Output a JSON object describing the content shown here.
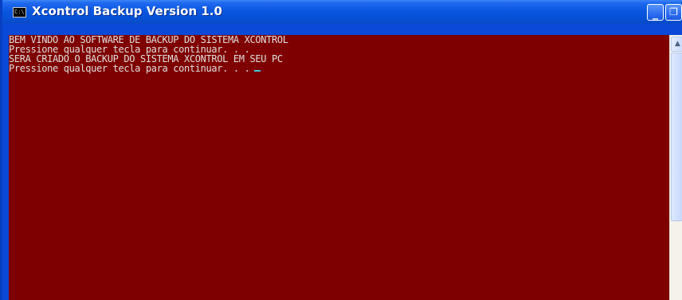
{
  "window": {
    "title": "Xcontrol Backup Version 1.0",
    "app_icon": "console-icon",
    "app_icon_glyph": "C:\\",
    "controls": {
      "minimize_glyph": "_",
      "maximize_glyph": "❐",
      "close_glyph": "✕"
    }
  },
  "console": {
    "background_color": "#7f0000",
    "text_color": "#e0e0e0",
    "cursor_color": "#3cc6d6",
    "lines": [
      "BEM VINDO AO SOFTWARE DE BACKUP DO SISTEMA XCONTROL",
      "Pressione qualquer tecla para continuar. . .",
      "SERA CRIADO O BACKUP DO SISTEMA XCONTROL EM SEU PC",
      "Pressione qualquer tecla para continuar. . ."
    ]
  },
  "scrollbar": {
    "up_arrow_glyph": "▲"
  }
}
